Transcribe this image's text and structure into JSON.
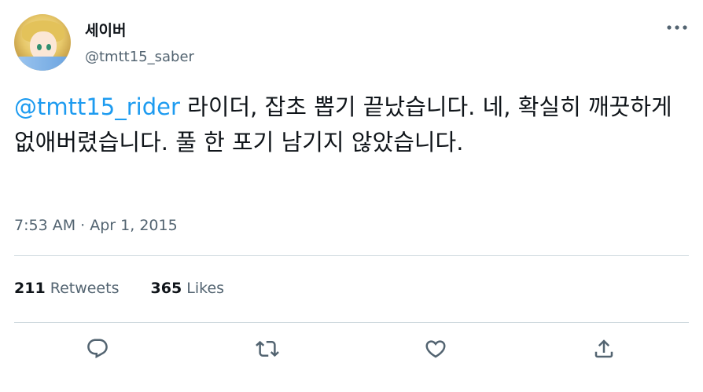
{
  "author": {
    "display_name": "세이버",
    "handle": "@tmtt15_saber",
    "avatar_caption": "twitter"
  },
  "tweet": {
    "mention": "@tmtt15_rider",
    "text": " 라이더, 잡초 뽑기 끝났습니다. 네, 확실히 깨끗하게 없애버렸습니다. 풀 한 포기 남기지 않았습니다.",
    "time": "7:53 AM",
    "separator": "·",
    "date": "Apr 1, 2015"
  },
  "stats": {
    "retweets_count": "211",
    "retweets_label": "Retweets",
    "likes_count": "365",
    "likes_label": "Likes"
  },
  "icons": {
    "more": "more-horizontal-icon",
    "reply": "reply-icon",
    "retweet": "retweet-icon",
    "like": "like-icon",
    "share": "share-icon"
  },
  "colors": {
    "link": "#1d9bf0",
    "secondary_text": "#536471",
    "divider": "#cfd9de"
  }
}
